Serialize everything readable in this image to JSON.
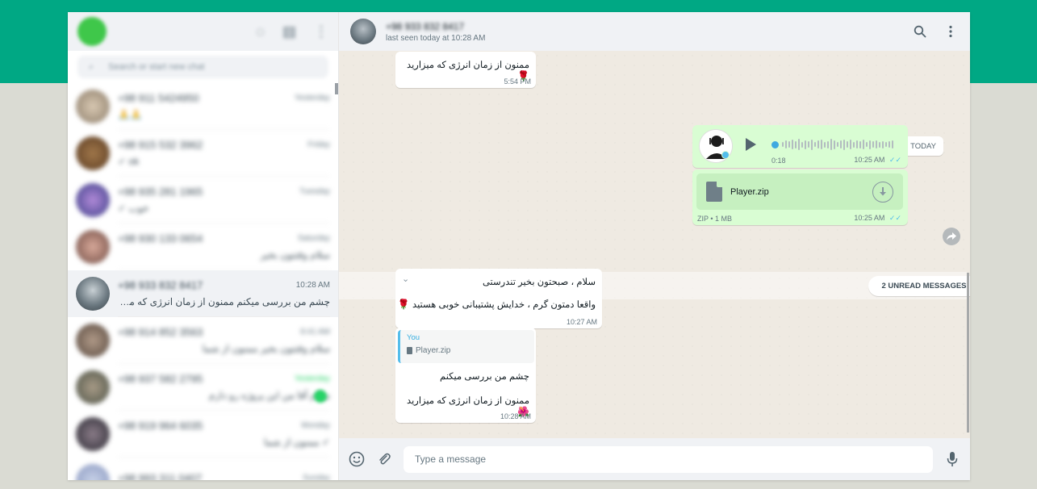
{
  "colors": {
    "brand": "#00a884",
    "outgoing_bubble": "#d9fdd3",
    "incoming_bubble": "#ffffff",
    "link_blue": "#53bdeb",
    "unread_green": "#25d366"
  },
  "sidebar": {
    "header_icons": [
      "status-icon",
      "new-chat-icon",
      "menu-icon"
    ],
    "search_placeholder": "Search or start new chat",
    "chats": [
      {
        "name": "+98 911 5424950",
        "time": "Yesterday",
        "preview": "🙏🙏",
        "blurred": true
      },
      {
        "name": "+98 915 532 3962",
        "time": "Friday",
        "preview": "✓ ok",
        "blurred": true
      },
      {
        "name": "+98 935 281 1965",
        "time": "Tuesday",
        "preview": "✓ خوب",
        "blurred": true
      },
      {
        "name": "+98 930 133 0654",
        "time": "Saturday",
        "preview": "سلام وقتتون بخیر",
        "blurred": true
      },
      {
        "name": "+98 933 832 8417",
        "time": "10:28 AM",
        "preview": "چشم من بررسی میکنم  ممنون از زمان انرژی که میزارید...",
        "blurred": false
      },
      {
        "name": "+98 914 852 3563",
        "time": "8:41 AM",
        "preview": "سلام وقتتون بخیر ممنون از شما",
        "blurred": true
      },
      {
        "name": "+98 937 582 2795",
        "time": "Yesterday",
        "preview": "سلام آقا من این پروژه رو دارم",
        "blurred": true
      },
      {
        "name": "+98 919 964 6035",
        "time": "Monday",
        "preview": "✓ ممنون از شما",
        "blurred": true
      },
      {
        "name": "+98 993 311 0407",
        "time": "Sunday",
        "preview": "",
        "blurred": true
      }
    ]
  },
  "chat": {
    "contact_name": "+98 933 832 8417",
    "status": "last seen today at 10:28 AM",
    "header_icons": [
      "search-icon",
      "menu-icon"
    ],
    "messages": {
      "prev_msg": {
        "text": "ممنون از زمان انرژی که میزارید",
        "emoji": "🌹",
        "time": "5:54 PM"
      },
      "date_divider": "TODAY",
      "voice": {
        "duration": "0:18",
        "time": "10:25 AM"
      },
      "file": {
        "name": "Player.zip",
        "meta": "ZIP • 1 MB",
        "time": "10:25 AM"
      },
      "unread_divider": "2 UNREAD MESSAGES",
      "incoming": {
        "line1": "سلام ، صبحتون بخیر تندرستی",
        "line2": "واقعا دمتون گرم ، خدایش پشتیبانی خوبی هستید",
        "emoji": "🌹",
        "time": "10:27 AM"
      },
      "reply": {
        "quote_author": "You",
        "quote_file": "Player.zip",
        "line1": "چشم من بررسی میکنم",
        "line2": "ممنون از زمان انرژی که میزارید",
        "emoji": "🌺",
        "time": "10:28 AM"
      }
    }
  },
  "composer": {
    "placeholder": "Type a message",
    "icons": [
      "emoji-icon",
      "attach-icon",
      "mic-icon"
    ]
  }
}
